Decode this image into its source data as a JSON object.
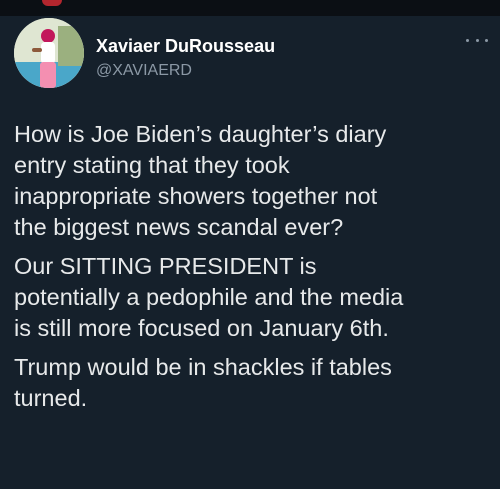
{
  "author": {
    "display_name": "Xaviaer DuRousseau",
    "handle": "@XAVIAERD"
  },
  "icons": {
    "avatar": "profile-photo",
    "more": "more-options-icon"
  },
  "colors": {
    "background": "#15202b",
    "text": "#e7e9ea",
    "secondary_text": "#8b98a5"
  },
  "tweet": {
    "paragraphs": [
      "How is Joe Biden’s daughter’s diary\nentry stating that they took\ninappropriate showers together not\nthe biggest news scandal ever?",
      "Our SITTING PRESIDENT is\npotentially a pedophile and the media\nis still more focused on January 6th.",
      "Trump would be in shackles if tables\nturned."
    ]
  }
}
